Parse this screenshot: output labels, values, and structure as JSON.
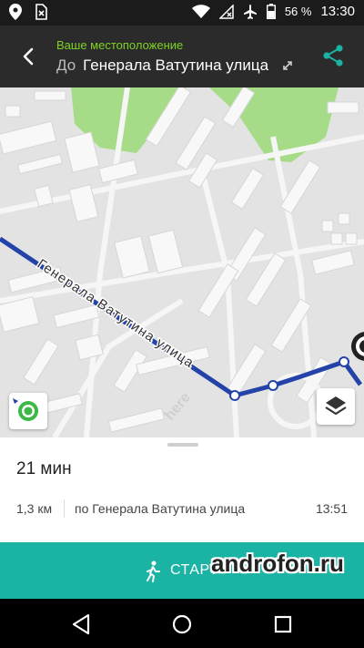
{
  "status_bar": {
    "battery": "56 %",
    "time": "13:30",
    "icons": [
      "location-icon",
      "sim-off-icon",
      "wifi-icon",
      "no-signal-icon",
      "airplane-icon",
      "battery-icon"
    ]
  },
  "header": {
    "origin": "Ваше местоположение",
    "to_prefix": "До",
    "destination": "Генерала Ватутина улица"
  },
  "map": {
    "street_label": "Генерала Ватутина улица",
    "provider_logo": "here",
    "route_color": "#2343a8"
  },
  "summary": {
    "duration": "21 мин",
    "distance": "1,3 км",
    "via": "по Генерала Ватутина улица",
    "arrival": "13:51"
  },
  "start_button": {
    "label": "СТАРТ",
    "color": "#1bb3a4"
  },
  "watermark": "androfon.ru",
  "nav": [
    "back-icon",
    "home-icon",
    "recents-icon"
  ]
}
